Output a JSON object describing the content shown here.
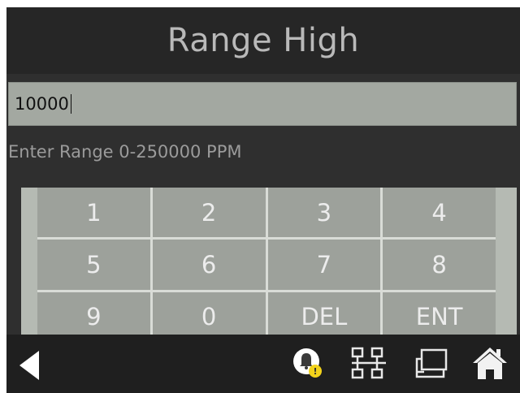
{
  "header": {
    "title": "Range High"
  },
  "entry": {
    "value": "10000"
  },
  "hint": "Enter Range 0-250000 PPM",
  "keypad": {
    "keys": [
      "1",
      "2",
      "3",
      "4",
      "5",
      "6",
      "7",
      "8",
      "9",
      "0",
      "DEL",
      "ENT"
    ]
  },
  "nav": {
    "icons": [
      "back-arrow-icon",
      "alarm-bell-icon",
      "network-icon",
      "display-icon",
      "home-icon"
    ],
    "alarm_badge_color": "#f2d21b"
  },
  "colors": {
    "background": "#2f2f2f",
    "title_bar": "#262626",
    "title_text": "#b9b9b9",
    "entry_field": "#a3a8a1",
    "key": "#9da19b",
    "key_text": "#ececec",
    "bottom_bar": "#1f1f1f"
  }
}
